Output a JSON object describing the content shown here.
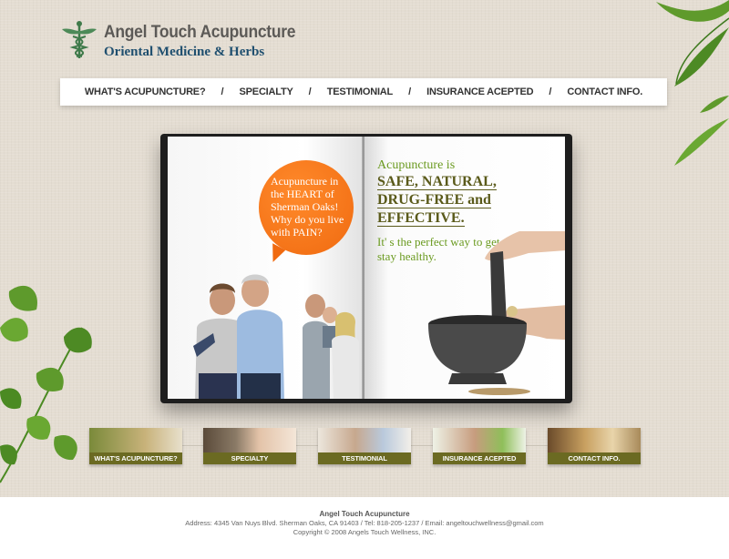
{
  "brand": {
    "title": "Angel Touch Acupuncture",
    "subtitle": "Oriental Medicine & Herbs",
    "logo_icon": "caduceus-icon"
  },
  "nav": {
    "items": [
      {
        "label": "WHAT'S ACUPUNCTURE?"
      },
      {
        "label": "SPECIALTY"
      },
      {
        "label": "TESTIMONIAL"
      },
      {
        "label": "INSURANCE ACEPTED"
      },
      {
        "label": "CONTACT INFO."
      }
    ],
    "separator": "/"
  },
  "book": {
    "bubble_text": "Acupuncture in the HEART of Sherman Oaks! Why do you live with PAIN?",
    "right_intro": "Acupuncture is",
    "right_big": [
      "SAFE, NATURAL,",
      "DRUG-FREE and",
      "EFFECTIVE."
    ],
    "right_tagline": "It' s the perfect way to get well and stay healthy."
  },
  "thumbnails": [
    {
      "label": "WHAT'S ACUPUNCTURE?"
    },
    {
      "label": "SPECIALTY"
    },
    {
      "label": "TESTIMONIAL"
    },
    {
      "label": "INSURANCE ACEPTED"
    },
    {
      "label": "CONTACT INFO."
    }
  ],
  "footer": {
    "title": "Angel Touch Acupuncture",
    "address": "Address: 4345 Van Nuys Blvd. Sherman Oaks, CA 91403 / Tel: 818-205-1237 / Email: angeltouchwellness@gmail.com",
    "copyright": "Copyright © 2008 Angels Touch Wellness, INC."
  },
  "colors": {
    "accent_orange": "#f06a10",
    "accent_green": "#6a9a1f",
    "olive_label": "#6b6a22",
    "brand_blue": "#1f4f6f"
  }
}
